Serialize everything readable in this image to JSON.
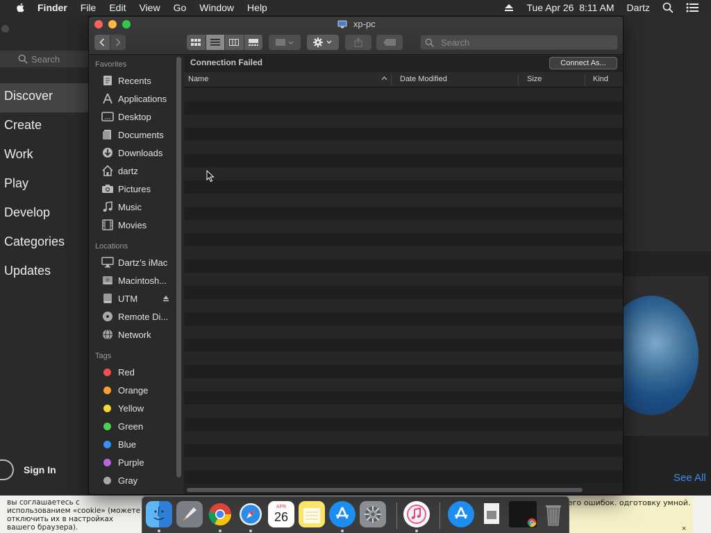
{
  "menubar": {
    "app_name": "Finder",
    "menus": [
      "File",
      "Edit",
      "View",
      "Go",
      "Window",
      "Help"
    ],
    "datetime": "Tue Apr 26  8:11 AM",
    "user": "Dartz"
  },
  "appstore": {
    "search_placeholder": "Search",
    "nav": [
      "Discover",
      "Create",
      "Work",
      "Play",
      "Develop",
      "Categories",
      "Updates"
    ],
    "active_nav": "Discover",
    "sign_in": "Sign In",
    "see_all": "See All"
  },
  "browser": {
    "cookie_left": "вы соглашаетесь с использованием «cookie» (можете отключить их в настройках вашего браузера).",
    "cookie_right": "его ошибок. одготовку умной.",
    "cookie_close": "×"
  },
  "finder": {
    "title": "xp-pc",
    "search_placeholder": "Search",
    "status": "Connection Failed",
    "connect_button": "Connect As...",
    "columns": {
      "name": "Name",
      "date": "Date Modified",
      "size": "Size",
      "kind": "Kind"
    },
    "sidebar": {
      "favorites_heading": "Favorites",
      "favorites": [
        {
          "label": "Recents",
          "icon": "recents-icon"
        },
        {
          "label": "Applications",
          "icon": "applications-icon"
        },
        {
          "label": "Desktop",
          "icon": "desktop-icon"
        },
        {
          "label": "Documents",
          "icon": "documents-icon"
        },
        {
          "label": "Downloads",
          "icon": "downloads-icon"
        },
        {
          "label": "dartz",
          "icon": "home-icon"
        },
        {
          "label": "Pictures",
          "icon": "camera-icon"
        },
        {
          "label": "Music",
          "icon": "music-note-icon"
        },
        {
          "label": "Movies",
          "icon": "film-icon"
        }
      ],
      "locations_heading": "Locations",
      "locations": [
        {
          "label": "Dartz’s iMac",
          "icon": "imac-icon"
        },
        {
          "label": "Macintosh...",
          "icon": "hard-drive-icon"
        },
        {
          "label": "UTM",
          "icon": "external-drive-icon"
        },
        {
          "label": "Remote Di...",
          "icon": "remote-disc-icon"
        },
        {
          "label": "Network",
          "icon": "network-globe-icon"
        }
      ],
      "tags_heading": "Tags",
      "tags": [
        {
          "label": "Red",
          "color": "#f0504d"
        },
        {
          "label": "Orange",
          "color": "#f5a030"
        },
        {
          "label": "Yellow",
          "color": "#f5d836"
        },
        {
          "label": "Green",
          "color": "#4fd056"
        },
        {
          "label": "Blue",
          "color": "#3a8ff5"
        },
        {
          "label": "Purple",
          "color": "#b865e0"
        },
        {
          "label": "Gray",
          "color": "#a8a8a8"
        }
      ]
    }
  },
  "dock": {
    "apps": [
      "finder",
      "launchpad",
      "chrome",
      "safari",
      "calendar",
      "notes",
      "app-store",
      "system-preferences",
      "itunes",
      "app-store-2",
      "preview",
      "chrome-app",
      "trash"
    ],
    "calendar_month": "APR",
    "calendar_day": "26"
  },
  "colors": {
    "accent_link": "#3d8df0",
    "close": "#fc605b",
    "minimize": "#fdbc40",
    "maximize": "#34c84a"
  }
}
